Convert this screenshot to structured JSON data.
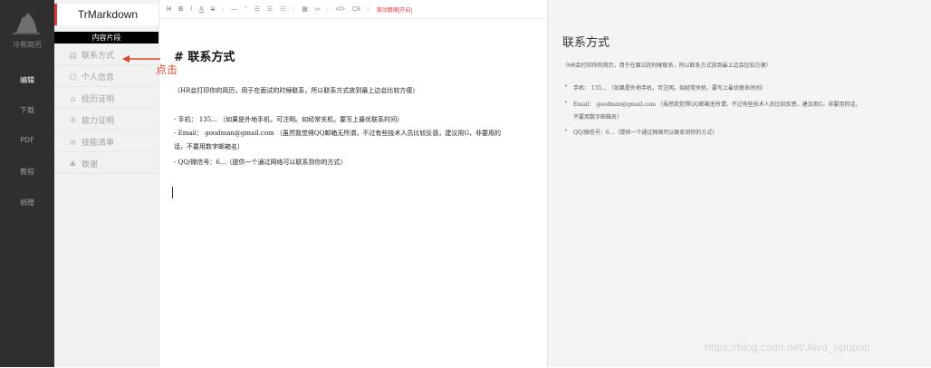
{
  "nav": {
    "brand": "冷熊简历",
    "items": [
      "编辑",
      "下载",
      "PDF",
      "教程",
      "捐赠"
    ]
  },
  "sidebar": {
    "app_title": "TrMarkdown",
    "section_header": "内容片段",
    "items": [
      {
        "icon": "card-icon",
        "label": "联系方式"
      },
      {
        "icon": "smile-icon",
        "label": "个人信息"
      },
      {
        "icon": "building-icon",
        "label": "经历证明"
      },
      {
        "icon": "chart-icon",
        "label": "能力证明"
      },
      {
        "icon": "list-icon",
        "label": "技能清单"
      },
      {
        "icon": "thumb-icon",
        "label": "致谢"
      }
    ]
  },
  "annotation": {
    "label": "点击"
  },
  "toolbar": {
    "buttons": [
      "H",
      "B",
      "I",
      "A",
      "S",
      "—",
      "“",
      "☰",
      "☰",
      "☷",
      "▦",
      "∞",
      "</>",
      "C8"
    ],
    "sync_label": "滚动跟随[开启]"
  },
  "editor": {
    "heading": "# 联系方式",
    "intro": "（HR会打印你的简历，用于在面试的时候联系，所以联系方式放到最上边会比较方便）",
    "lines": [
      "- 手机： 135...  （如果是外地手机，可注明。如经常关机，要写上最优联系时间）",
      "- Email： goodman@gmail.com  （虽然我觉得QQ邮箱无所谓，不过有些技术人员比较反感，建议用G，非要用的",
      "话，不要用数字邮箱名）",
      "- QQ/微信号：6...（提供一个通过网络可以联系到你的方式）"
    ]
  },
  "preview": {
    "heading": "联系方式",
    "intro": "（HR会打印你的简历，用于在面试的时候联系，所以联系方式放到最上边会比较方便）",
    "items": [
      "手机： 135...  （如果是外地手机，可注明。如经常关机，要写上最优联系时间）",
      "Email： goodman@gmail.com  （虽然我觉得QQ邮箱无所谓，不过有些技术人员比较反感，建议用G，非要用的话，",
      "QQ/微信号：6...（提供一个通过网络可以联系到你的方式）"
    ],
    "continuation": "不要用数字邮箱名）"
  },
  "watermark": "https://blog.csdn.net/Java_upupup",
  "colors": {
    "accent": "#e03b3b",
    "nav_bg": "#2f2f2f",
    "sidebar_bg": "#f1f1f1",
    "preview_bg": "#f4f4f4"
  }
}
